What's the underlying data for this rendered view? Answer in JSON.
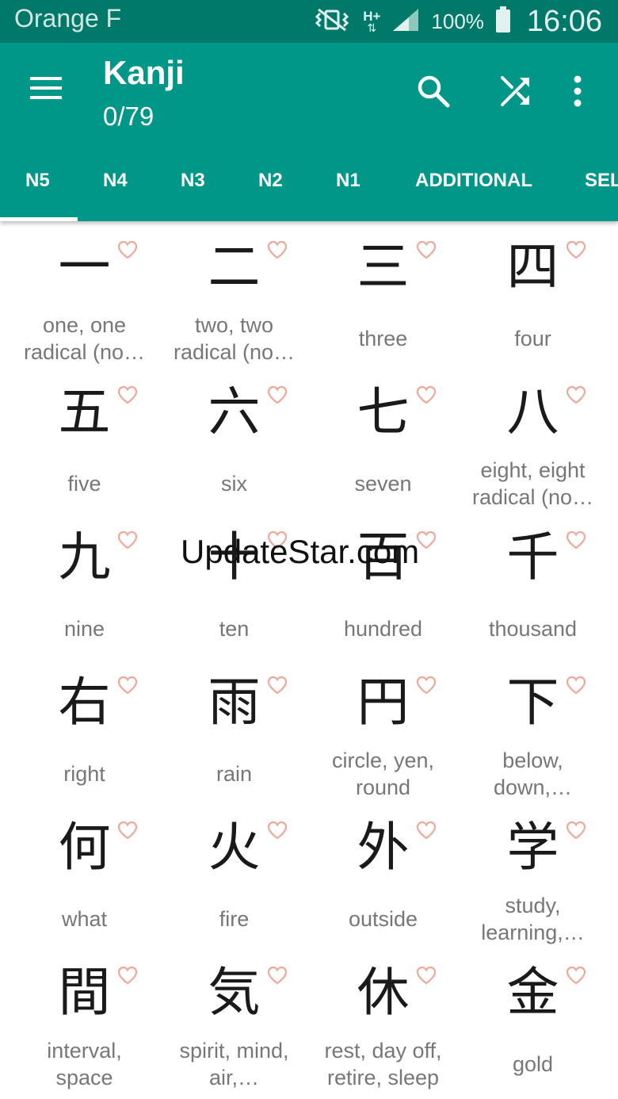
{
  "status_bar": {
    "carrier": "Orange F",
    "network_type": "H+",
    "battery": "100%",
    "time": "16:06"
  },
  "app_bar": {
    "title": "Kanji",
    "subtitle": "0/79"
  },
  "tabs": [
    {
      "label": "N5",
      "selected": true
    },
    {
      "label": "N4",
      "selected": false
    },
    {
      "label": "N3",
      "selected": false
    },
    {
      "label": "N2",
      "selected": false
    },
    {
      "label": "N1",
      "selected": false
    },
    {
      "label": "ADDITIONAL",
      "selected": false
    },
    {
      "label": "SEL",
      "selected": false
    }
  ],
  "kanji_list": [
    {
      "kanji": "一",
      "meaning": "one, one radical (no…"
    },
    {
      "kanji": "二",
      "meaning": "two, two radical (no…"
    },
    {
      "kanji": "三",
      "meaning": "three"
    },
    {
      "kanji": "四",
      "meaning": "four"
    },
    {
      "kanji": "五",
      "meaning": "five"
    },
    {
      "kanji": "六",
      "meaning": "six"
    },
    {
      "kanji": "七",
      "meaning": "seven"
    },
    {
      "kanji": "八",
      "meaning": "eight, eight radical (no…"
    },
    {
      "kanji": "九",
      "meaning": "nine"
    },
    {
      "kanji": "十",
      "meaning": "ten"
    },
    {
      "kanji": "百",
      "meaning": "hundred"
    },
    {
      "kanji": "千",
      "meaning": "thousand"
    },
    {
      "kanji": "右",
      "meaning": "right"
    },
    {
      "kanji": "雨",
      "meaning": "rain"
    },
    {
      "kanji": "円",
      "meaning": "circle, yen, round"
    },
    {
      "kanji": "下",
      "meaning": "below, down,…"
    },
    {
      "kanji": "何",
      "meaning": "what"
    },
    {
      "kanji": "火",
      "meaning": "fire"
    },
    {
      "kanji": "外",
      "meaning": "outside"
    },
    {
      "kanji": "学",
      "meaning": "study, learning,…"
    },
    {
      "kanji": "間",
      "meaning": "interval, space"
    },
    {
      "kanji": "気",
      "meaning": "spirit, mind, air,…"
    },
    {
      "kanji": "休",
      "meaning": "rest, day off, retire, sleep"
    },
    {
      "kanji": "金",
      "meaning": "gold"
    }
  ],
  "watermark": "UpdateStar.com",
  "colors": {
    "status_bar": "#00796b",
    "app_bar": "#009688",
    "heart": "#f0a89b",
    "meaning_text": "#777777"
  },
  "icons": {
    "menu": "hamburger-menu-icon",
    "search": "search-icon",
    "shuffle": "shuffle-icon",
    "overflow": "more-vert-icon",
    "favorite": "heart-outline-icon"
  }
}
